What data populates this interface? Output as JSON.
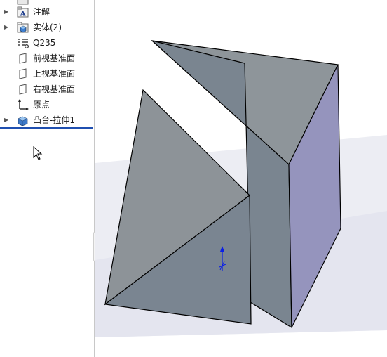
{
  "feature_tree": {
    "items": [
      {
        "label": "",
        "icon": "folder-icon",
        "expandable": false
      },
      {
        "label": "注解",
        "icon": "annotation-icon",
        "expandable": true
      },
      {
        "label": "实体(2)",
        "icon": "solid-bodies-icon",
        "expandable": true
      },
      {
        "label": "Q235",
        "icon": "material-icon",
        "expandable": false
      },
      {
        "label": "前视基准面",
        "icon": "plane-icon",
        "expandable": false
      },
      {
        "label": "上视基准面",
        "icon": "plane-icon",
        "expandable": false
      },
      {
        "label": "右视基准面",
        "icon": "plane-icon",
        "expandable": false
      },
      {
        "label": "原点",
        "icon": "origin-icon",
        "expandable": false
      },
      {
        "label": "凸台-拉伸1",
        "icon": "extrude-boss-icon",
        "expandable": true
      }
    ]
  },
  "viewport": {
    "background_color": "#ffffff",
    "floor_color": "#ecedf3",
    "face_top_color": "#8e959a",
    "face_front_color": "#7a8590",
    "face_side_color": "#9594bd",
    "triad_color": "#0a1fe6"
  },
  "colors": {
    "rollback_bar": "#1f4fb0"
  }
}
